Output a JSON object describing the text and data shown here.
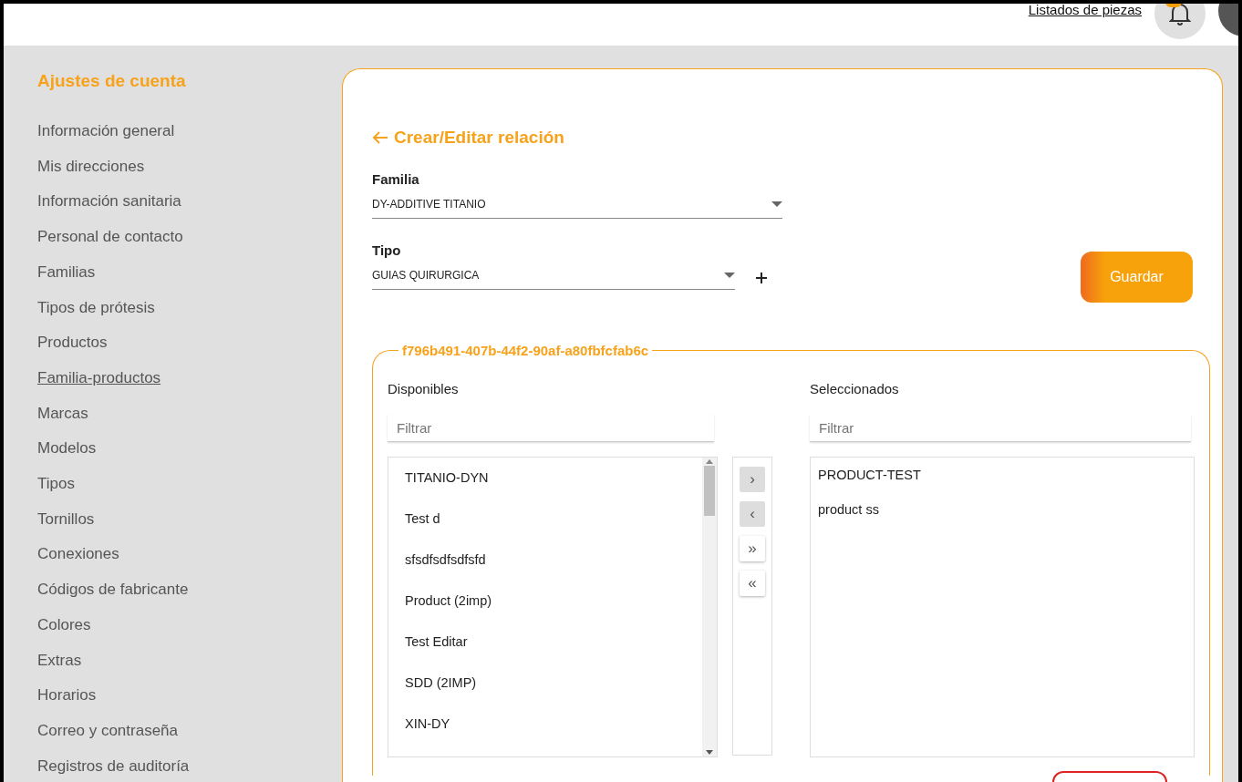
{
  "header": {
    "link": "Listados de piezas"
  },
  "sidebar": {
    "title": "Ajustes de cuenta",
    "items": [
      {
        "label": "Información general",
        "selected": false
      },
      {
        "label": "Mis direcciones",
        "selected": false
      },
      {
        "label": "Información sanitaria",
        "selected": false
      },
      {
        "label": "Personal de contacto",
        "selected": false
      },
      {
        "label": "Familias",
        "selected": false
      },
      {
        "label": "Tipos de prótesis",
        "selected": false
      },
      {
        "label": "Productos",
        "selected": false
      },
      {
        "label": "Familia-productos",
        "selected": true
      },
      {
        "label": "Marcas",
        "selected": false
      },
      {
        "label": "Modelos",
        "selected": false
      },
      {
        "label": "Tipos",
        "selected": false
      },
      {
        "label": "Tornillos",
        "selected": false
      },
      {
        "label": "Conexiones",
        "selected": false
      },
      {
        "label": "Códigos de fabricante",
        "selected": false
      },
      {
        "label": "Colores",
        "selected": false
      },
      {
        "label": "Extras",
        "selected": false
      },
      {
        "label": "Horarios",
        "selected": false
      },
      {
        "label": "Correo y contraseña",
        "selected": false
      },
      {
        "label": "Registros de auditoría",
        "selected": false
      }
    ]
  },
  "form": {
    "title": "Crear/Editar relación",
    "save_button": "Guardar",
    "fields": [
      {
        "label": "Familia",
        "value": "DY-ADDITIVE TITANIO",
        "addable": false
      },
      {
        "label": "Tipo",
        "value": "GUIAS QUIRURGICA",
        "addable": true
      }
    ]
  },
  "relation": {
    "legend": "f796b491-407b-44f2-90af-a80fbfcfab6c",
    "available": {
      "title": "Disponibles",
      "filter_placeholder": "Filtrar",
      "items": [
        "TITANIO-DYN",
        "Test d",
        "sfsdfsdfsdfsfd",
        "Product (2imp)",
        "Test Editar",
        "SDD (2IMP)",
        "XIN-DY"
      ]
    },
    "transfer_buttons": [
      {
        "label": "›",
        "disabled": true
      },
      {
        "label": "‹",
        "disabled": true
      },
      {
        "label": "»",
        "disabled": false
      },
      {
        "label": "«",
        "disabled": false
      }
    ],
    "selected": {
      "title": "Seleccionados",
      "filter_placeholder": "Filtrar",
      "items": [
        "PRODUCT-TEST",
        "product ss"
      ]
    }
  }
}
